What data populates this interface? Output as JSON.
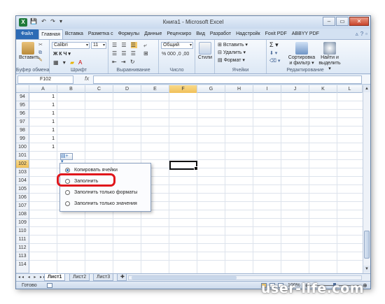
{
  "window": {
    "title": "Книга1 - Microsoft Excel",
    "qat": "💾 ↶ ↷ ▾"
  },
  "tabs": [
    "Файл",
    "Главная",
    "Вставка",
    "Разметка с",
    "Формулы",
    "Данные",
    "Рецензиро",
    "Вид",
    "Разработ",
    "Надстройк",
    "Foxit PDF",
    "ABBYY PDF"
  ],
  "ribbon": {
    "paste_label": "Вставить",
    "font_name": "Calibri",
    "font_size": "11",
    "font_styles": "Ж  К  Ч ▾",
    "number_format": "Общий",
    "styles_label": "Стили",
    "insert_cells": "Вставить ▾",
    "delete_cells": "Удалить ▾",
    "format_cells": "Формат ▾",
    "sum_sign": "Σ ▾",
    "sort_label": "Сортировка и фильтр ▾",
    "find_label": "Найти и выделить ▾",
    "group_labels": [
      "Буфер обмена",
      "Шрифт",
      "Выравнивание",
      "Число",
      "Ячейки",
      "Редактирование"
    ],
    "number_symbols": "%  000  ,0  ,00"
  },
  "formula_bar": {
    "name_box": "F102",
    "fx": "fx",
    "value": ""
  },
  "columns": [
    "A",
    "B",
    "C",
    "D",
    "E",
    "F",
    "G",
    "H",
    "I",
    "J",
    "K",
    "L"
  ],
  "rows": [
    "94",
    "95",
    "96",
    "97",
    "98",
    "99",
    "100",
    "101",
    "102",
    "103",
    "104",
    "105",
    "106",
    "107",
    "108",
    "109",
    "110",
    "111",
    "112",
    "113",
    "114"
  ],
  "column_a_values": [
    "1",
    "1",
    "1",
    "1",
    "1",
    "1",
    "1"
  ],
  "autofill_menu": {
    "options": [
      "Копировать ячейки",
      "Заполнить",
      "Заполнить только форматы",
      "Заполнить только значения"
    ],
    "selected_index": 0,
    "highlighted_option": "Заполнить"
  },
  "sheets": [
    "Лист1",
    "Лист2",
    "Лист3"
  ],
  "active_sheet": "Лист1",
  "status": {
    "ready": "Готово",
    "zoom": "100%"
  },
  "watermark": "user-life.com",
  "colors": {
    "accent": "#2d6bb5",
    "highlight_border": "#e0161b",
    "selected_header": "#f1c15a"
  }
}
